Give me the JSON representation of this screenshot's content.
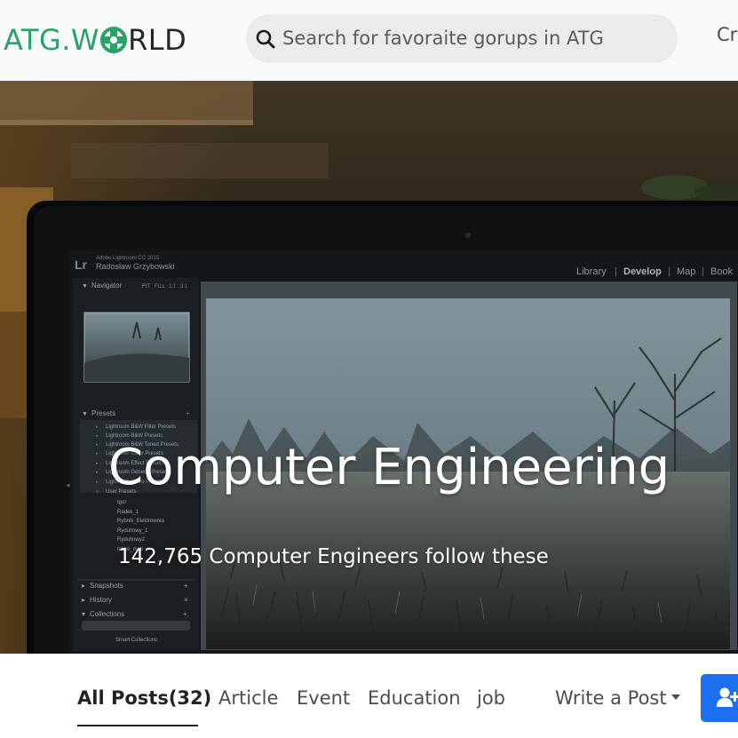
{
  "header": {
    "logo": {
      "part1": "ATG.W",
      "part2": "RLD",
      "colors": {
        "green": "#27a365",
        "dark": "#262626"
      }
    },
    "search": {
      "placeholder": "Search for favoraite gorups in ATG",
      "icon": "search-icon"
    },
    "create_label_partial": "Cr"
  },
  "hero": {
    "title": "Computer Engineering",
    "subtitle": "142,765 Computer Engineers follow these",
    "screen": {
      "app_name": "Lr",
      "app_version": "Adobe Lightroom CC 2015",
      "user_name": "Radosław Grzybowski",
      "modules": [
        "Library",
        "Develop",
        "Map",
        "Book"
      ],
      "left_panel": {
        "navigator": {
          "title": "Navigator",
          "zoom_options": [
            "FIT",
            "FILL",
            "1:1",
            "3:1"
          ]
        },
        "presets": {
          "title": "Presets",
          "items": [
            "Lightroom B&W Filter Presets",
            "Lightroom B&W Presets",
            "Lightroom B&W Toned Presets",
            "Lightroom Color Presets",
            "Lightroom Effect Presets",
            "Lightroom General Presets",
            "Lightroom Video Presets",
            "User Presets"
          ],
          "user_presets": [
            "Igor",
            "Radek_1",
            "Rybnik_Elektrownia",
            "Rydultowy_1",
            "Rydultowy2",
            "tetice_mati"
          ]
        },
        "snapshots": "Snapshots",
        "history": "History",
        "collections": "Collections",
        "smart_collections": "Smart Collections"
      }
    }
  },
  "tabs": {
    "items": [
      {
        "label": "All Posts(32)",
        "active": true
      },
      {
        "label": "Article",
        "active": false
      },
      {
        "label": "Event",
        "active": false
      },
      {
        "label": "Education",
        "active": false
      },
      {
        "label": "job",
        "active": false
      }
    ],
    "write_post": "Write a Post",
    "join_icon": "add-user-icon",
    "accent_color": "#1d6ff2"
  }
}
